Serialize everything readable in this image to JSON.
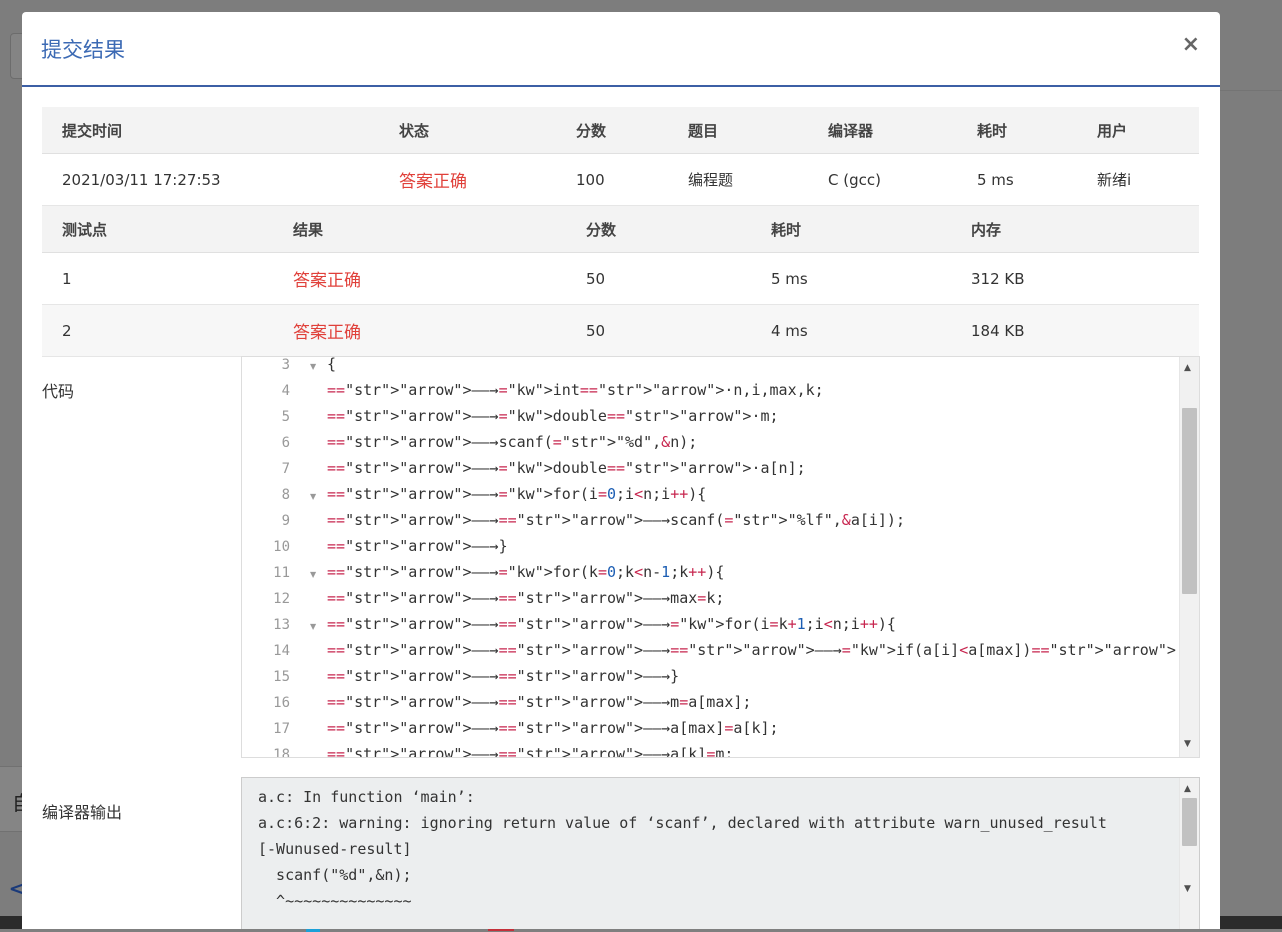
{
  "background": {
    "partial_char": "自",
    "back_chevron": "<"
  },
  "modal": {
    "title": "提交结果",
    "close_glyph": "×",
    "submission": {
      "headers": [
        "提交时间",
        "状态",
        "分数",
        "题目",
        "编译器",
        "耗时",
        "用户"
      ],
      "row": [
        "2021/03/11 17:27:53",
        "答案正确",
        "100",
        "编程题",
        "C (gcc)",
        "5 ms",
        "新绪i"
      ]
    },
    "testcases": {
      "headers": [
        "测试点",
        "结果",
        "分数",
        "耗时",
        "内存"
      ],
      "rows": [
        [
          "1",
          "答案正确",
          "50",
          "5 ms",
          "312 KB"
        ],
        [
          "2",
          "答案正确",
          "50",
          "4 ms",
          "184 KB"
        ]
      ]
    },
    "code_label": "代码",
    "code": {
      "line_numbers": [
        "3",
        "4",
        "5",
        "6",
        "7",
        "8",
        "9",
        "10",
        "11",
        "12",
        "13",
        "14",
        "15",
        "16",
        "17",
        "18"
      ],
      "fold_lines": [
        "3",
        "8",
        "11",
        "13"
      ],
      "lines": [
        "{",
        "→int·n,i,max,k;",
        "→double·m;",
        "→scanf(\"%d\",&n);",
        "→double·a[n];",
        "→for(i=0;i<n;i++){",
        "→→scanf(\"%lf\",&a[i]);",
        "→}",
        "→for(k=0;k<n-1;k++){",
        "→→max=k;",
        "→→for(i=k+1;i<n;i++){",
        "→→→if(a[i]<a[max])·max=i;",
        "→→}",
        "→→m=a[max];",
        "→→a[max]=a[k];",
        "→→a[k]=m;"
      ]
    },
    "output_label": "编译器输出",
    "compiler_output": [
      "a.c: In function ‘main’:",
      "a.c:6:2: warning: ignoring return value of ‘scanf’, declared with attribute warn_unused_result",
      "[-Wunused-result]",
      "  scanf(\"%d\",&n);",
      "  ^~~~~~~~~~~~~~~"
    ],
    "colors": {
      "title": "#3c6ab4",
      "accepted": "#e0403a",
      "header_rule": "#3c5fa5"
    }
  }
}
